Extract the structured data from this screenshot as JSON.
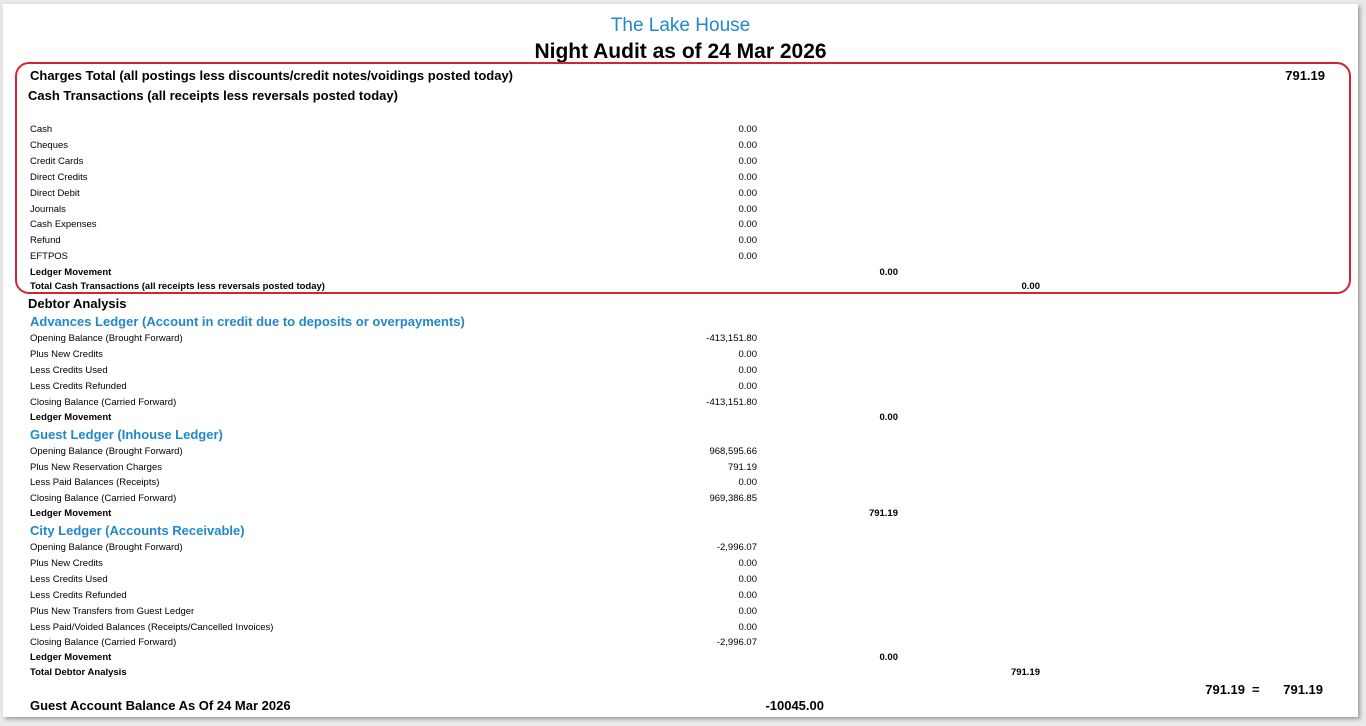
{
  "report": {
    "hotel_name": "The Lake House",
    "title": "Night Audit as of 24 Mar 2026"
  },
  "charges_total": {
    "label": "Charges Total (all postings less discounts/credit notes/voidings posted today)",
    "value": "791.19"
  },
  "cash_transactions": {
    "heading": "Cash Transactions (all receipts less reversals posted today)",
    "rows": [
      {
        "label": "Cash",
        "value": "0.00"
      },
      {
        "label": "Cheques",
        "value": "0.00"
      },
      {
        "label": "Credit Cards",
        "value": "0.00"
      },
      {
        "label": "Direct Credits",
        "value": "0.00"
      },
      {
        "label": "Direct Debit",
        "value": "0.00"
      },
      {
        "label": "Journals",
        "value": "0.00"
      },
      {
        "label": "Cash Expenses",
        "value": "0.00"
      },
      {
        "label": "Refund",
        "value": "0.00"
      },
      {
        "label": "EFTPOS",
        "value": "0.00"
      }
    ],
    "ledger_movement_label": "Ledger Movement",
    "ledger_movement_value": "0.00",
    "total_label": "Total Cash Transactions (all receipts less reversals posted today)",
    "total_value": "0.00"
  },
  "debtor_analysis": {
    "heading": "Debtor Analysis",
    "advances": {
      "title": "Advances Ledger (Account in credit due to deposits or overpayments)",
      "rows": [
        {
          "label": "Opening Balance (Brought Forward)",
          "value": "-413,151.80"
        },
        {
          "label": "Plus New Credits",
          "value": "0.00"
        },
        {
          "label": "Less Credits Used",
          "value": "0.00"
        },
        {
          "label": "Less Credits Refunded",
          "value": "0.00"
        },
        {
          "label": "Closing Balance (Carried Forward)",
          "value": "-413,151.80"
        }
      ],
      "ledger_movement_label": "Ledger Movement",
      "ledger_movement_value": "0.00"
    },
    "guest": {
      "title": "Guest Ledger (Inhouse Ledger)",
      "rows": [
        {
          "label": "Opening Balance (Brought Forward)",
          "value": "968,595.66"
        },
        {
          "label": "Plus New Reservation Charges",
          "value": "791.19"
        },
        {
          "label": "Less Paid Balances (Receipts)",
          "value": "0.00"
        },
        {
          "label": "Closing Balance (Carried Forward)",
          "value": "969,386.85"
        }
      ],
      "ledger_movement_label": "Ledger Movement",
      "ledger_movement_value": "791.19"
    },
    "city": {
      "title": "City Ledger (Accounts Receivable)",
      "rows": [
        {
          "label": "Opening Balance (Brought Forward)",
          "value": "-2,996.07"
        },
        {
          "label": "Plus New Credits",
          "value": "0.00"
        },
        {
          "label": "Less Credits Used",
          "value": "0.00"
        },
        {
          "label": "Less Credits Refunded",
          "value": "0.00"
        },
        {
          "label": "Plus New Transfers from Guest Ledger",
          "value": "0.00"
        },
        {
          "label": "Less Paid/Voided Balances (Receipts/Cancelled Invoices)",
          "value": "0.00"
        },
        {
          "label": "Closing Balance (Carried Forward)",
          "value": "-2,996.07"
        }
      ],
      "ledger_movement_label": "Ledger Movement",
      "ledger_movement_value": "0.00"
    },
    "total_label": "Total Debtor Analysis",
    "total_value": "791.19"
  },
  "reconciliation": {
    "left": "791.19",
    "equals": "=",
    "right": "791.19"
  },
  "guest_account_balance": {
    "label": "Guest Account Balance As Of 24 Mar 2026",
    "value": "-10045.00"
  },
  "colors": {
    "heading_blue": "#2288c9",
    "highlight_red": "#d42433"
  }
}
